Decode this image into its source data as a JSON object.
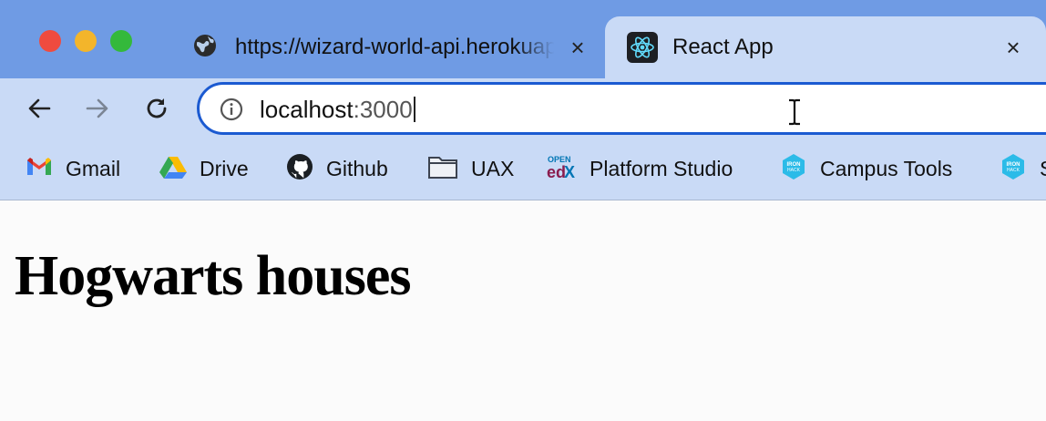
{
  "tabs": [
    {
      "title": "https://wizard-world-api.herokuapp.com/Houses",
      "icon": "globe-icon",
      "active": false
    },
    {
      "title": "React App",
      "icon": "react-icon",
      "active": true
    }
  ],
  "address_bar": {
    "host": "localhost",
    "port_suffix": ":3000"
  },
  "bookmarks": [
    {
      "label": "Gmail",
      "icon": "gmail-icon"
    },
    {
      "label": "Drive",
      "icon": "google-drive-icon"
    },
    {
      "label": "Github",
      "icon": "github-icon"
    },
    {
      "label": "UAX",
      "icon": "folder-icon"
    },
    {
      "label": "Platform Studio",
      "icon": "openedx-icon"
    },
    {
      "label": "Campus Tools",
      "icon": "ironhack-icon"
    },
    {
      "label": "S",
      "icon": "ironhack-icon"
    }
  ],
  "page": {
    "heading": "Hogwarts houses"
  },
  "colors": {
    "tab_strip": "#6f9be4",
    "toolbar": "#c9daf6",
    "focus_ring": "#1b5ad1"
  }
}
